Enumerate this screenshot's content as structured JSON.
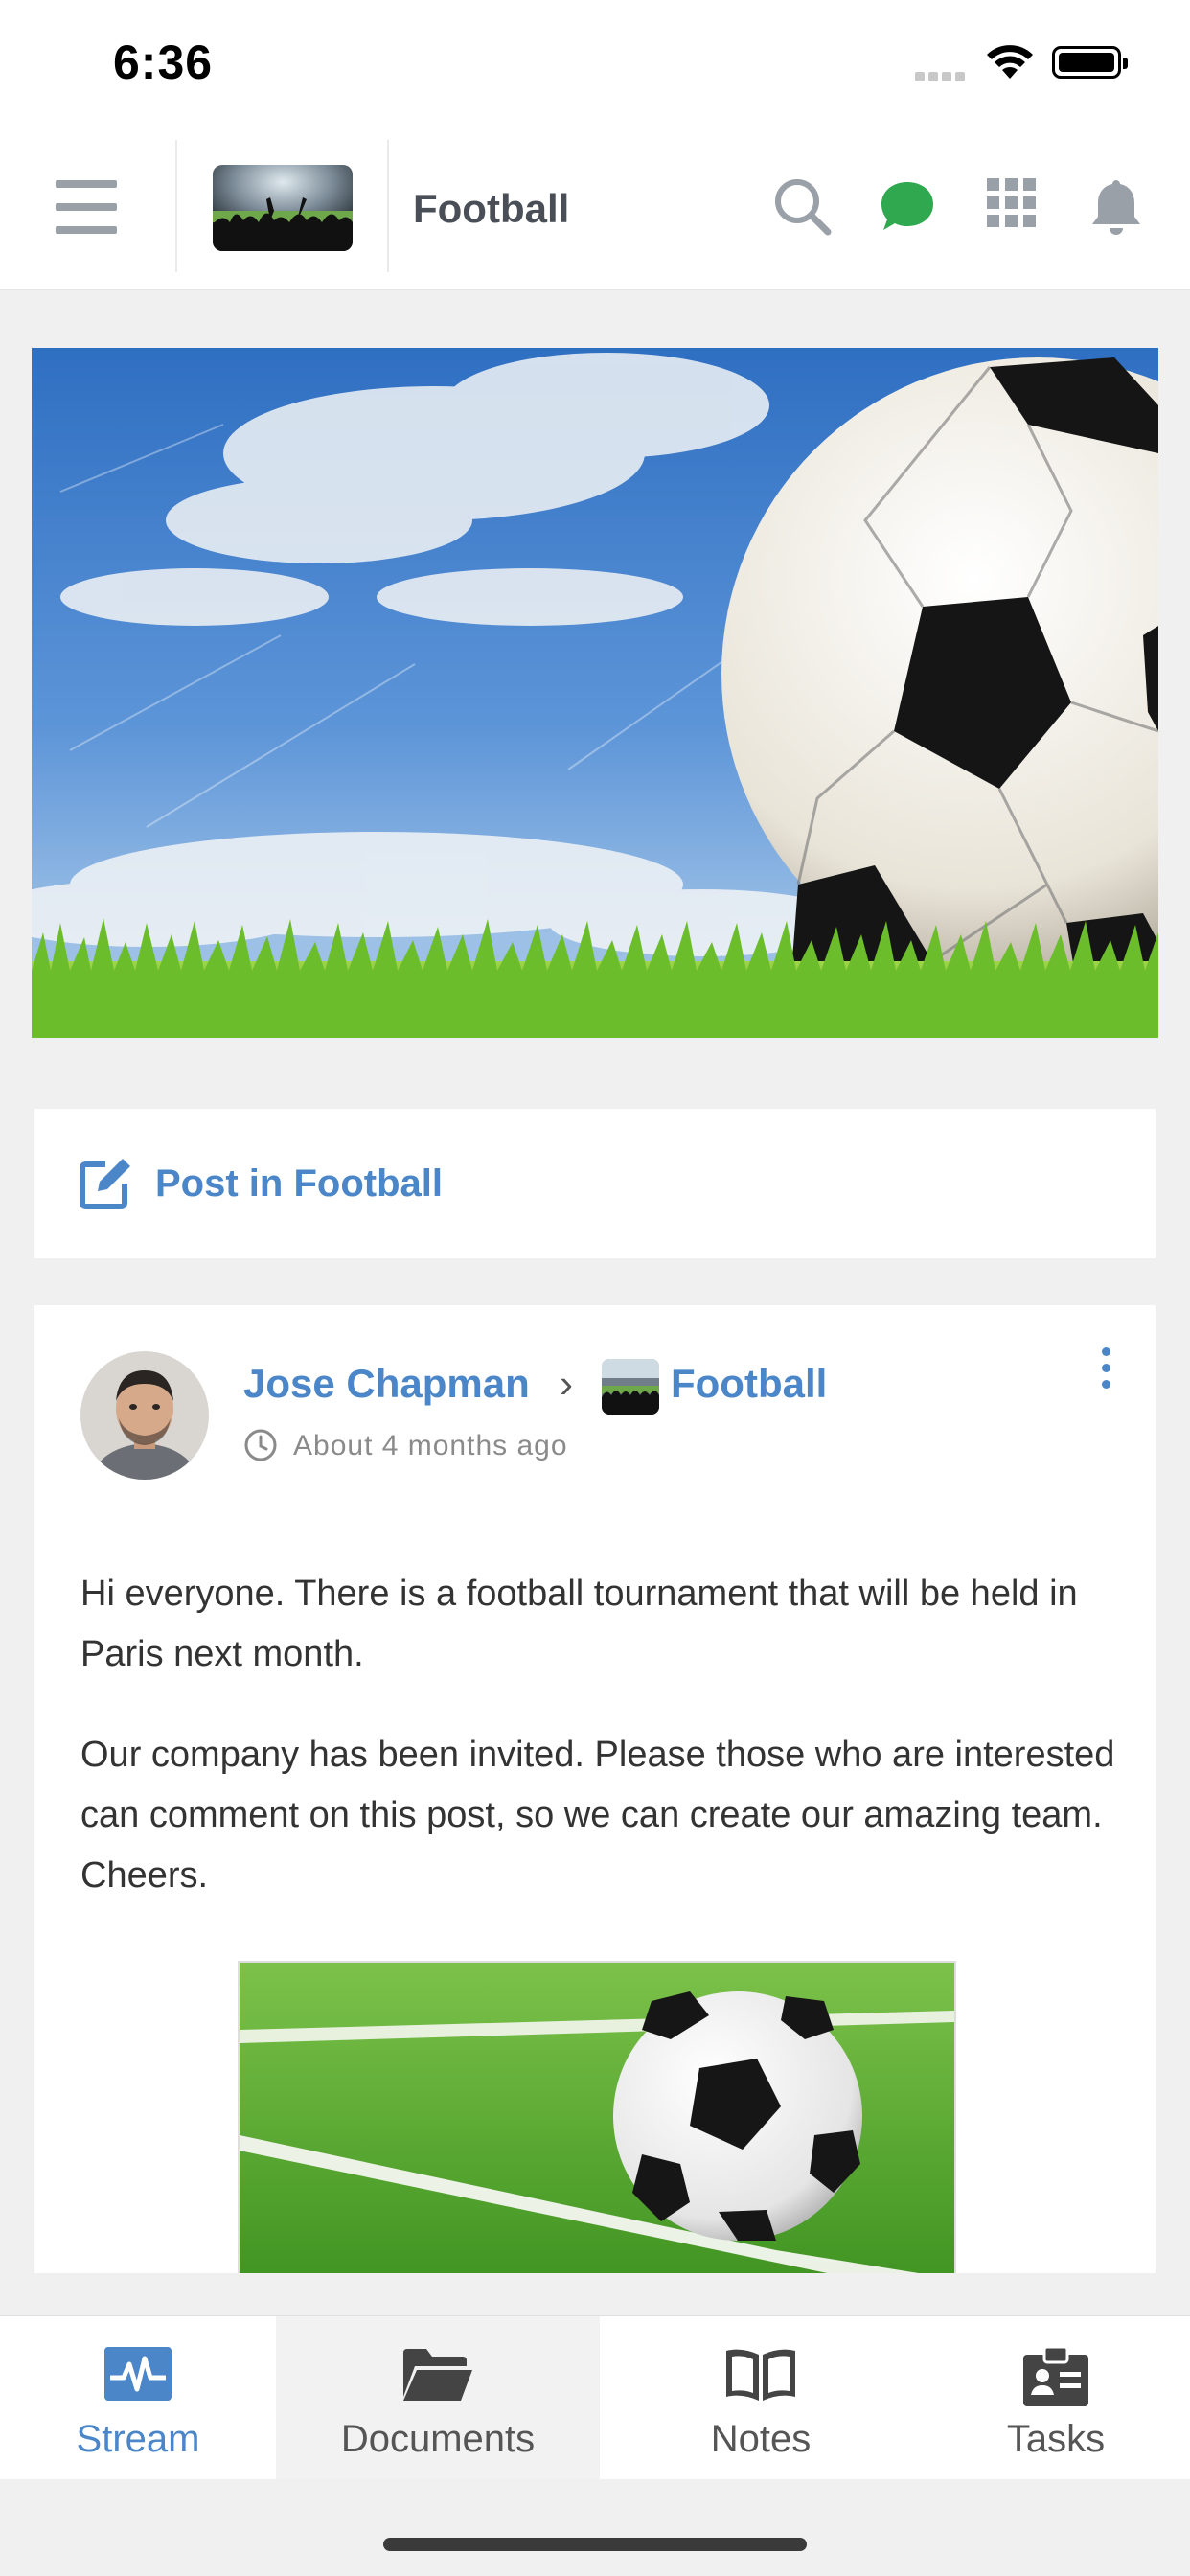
{
  "status_bar": {
    "time": "6:36"
  },
  "header": {
    "space_name": "Football"
  },
  "composer": {
    "label": "Post in Football"
  },
  "post": {
    "author": "Jose Chapman",
    "separator": "›",
    "space": "Football",
    "time_ago": "About 4 months ago",
    "paragraphs": [
      "Hi everyone. There is a football tournament that will be held in Paris next month.",
      "Our company has been invited. Please those who are interested can comment on this post, so we can create our amazing team. Cheers."
    ]
  },
  "tab_bar": {
    "tabs": [
      {
        "label": "Stream",
        "icon": "stream-icon",
        "active": true
      },
      {
        "label": "Documents",
        "icon": "folder-icon",
        "active": false
      },
      {
        "label": "Notes",
        "icon": "book-icon",
        "active": false
      },
      {
        "label": "Tasks",
        "icon": "clipboard-icon",
        "active": false
      }
    ]
  },
  "colors": {
    "accent": "#4a86c8",
    "chat_green": "#2fa84f",
    "icon_gray": "#9aa0a8",
    "background": "#f0f0f0"
  }
}
